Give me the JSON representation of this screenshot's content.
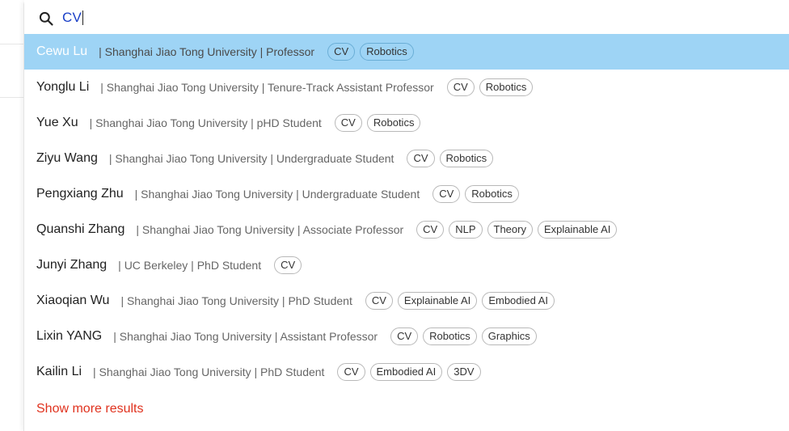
{
  "search": {
    "icon": "search-icon",
    "value": "CV",
    "text_color": "#1a3fc7"
  },
  "results": [
    {
      "name": "Cewu Lu",
      "meta": "| Shanghai Jiao Tong University | Professor",
      "tags": [
        "CV",
        "Robotics"
      ],
      "active": true
    },
    {
      "name": "Yonglu Li",
      "meta": "| Shanghai Jiao Tong University | Tenure-Track Assistant Professor",
      "tags": [
        "CV",
        "Robotics"
      ]
    },
    {
      "name": "Yue Xu",
      "meta": "| Shanghai Jiao Tong University | pHD Student",
      "tags": [
        "CV",
        "Robotics"
      ]
    },
    {
      "name": "Ziyu Wang",
      "meta": "| Shanghai Jiao Tong University | Undergraduate Student",
      "tags": [
        "CV",
        "Robotics"
      ]
    },
    {
      "name": "Pengxiang Zhu",
      "meta": "| Shanghai Jiao Tong University | Undergraduate Student",
      "tags": [
        "CV",
        "Robotics"
      ]
    },
    {
      "name": "Quanshi Zhang",
      "meta": "| Shanghai Jiao Tong University | Associate Professor",
      "tags": [
        "CV",
        "NLP",
        "Theory",
        "Explainable AI"
      ]
    },
    {
      "name": "Junyi Zhang",
      "meta": "| UC Berkeley | PhD Student",
      "tags": [
        "CV"
      ]
    },
    {
      "name": "Xiaoqian Wu",
      "meta": "| Shanghai Jiao Tong University | PhD Student",
      "tags": [
        "CV",
        "Explainable AI",
        "Embodied AI"
      ]
    },
    {
      "name": "Lixin YANG",
      "meta": "| Shanghai Jiao Tong University | Assistant Professor",
      "tags": [
        "CV",
        "Robotics",
        "Graphics"
      ]
    },
    {
      "name": "Kailin Li",
      "meta": "| Shanghai Jiao Tong University | PhD Student",
      "tags": [
        "CV",
        "Embodied AI",
        "3DV"
      ]
    }
  ],
  "show_more_label": "Show more results",
  "colors": {
    "highlight": "#9ed4f5",
    "show_more": "#e0321e"
  }
}
